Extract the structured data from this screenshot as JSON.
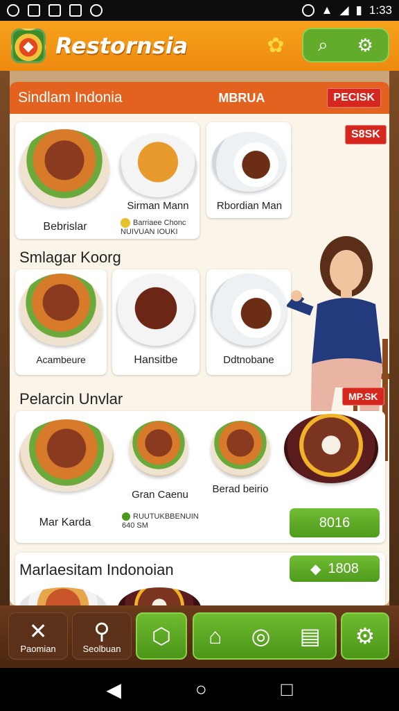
{
  "status": {
    "time": "1:33"
  },
  "app": {
    "title": "Restornsia"
  },
  "menu_header": {
    "left": "Sindlam Indonia",
    "middle": "MBRUA",
    "badge": "PECISK"
  },
  "row1": {
    "badge": "S8SK",
    "items": [
      {
        "label": "Bebrislar",
        "icon": "bowl"
      },
      {
        "label": "Sirman Mann",
        "icon": "noodles"
      },
      {
        "label": "Rbordian Man",
        "icon": "plate"
      }
    ],
    "note_line1": "Barriaee Chonc",
    "note_line2": "NUIVUAN IOUKI"
  },
  "section2": {
    "title": "Smlagar Koorg",
    "items": [
      {
        "label": "Acambeure"
      },
      {
        "label": "Hansitbe"
      },
      {
        "label": "Ddtnobane"
      }
    ]
  },
  "section3": {
    "title": "Pelarcin Unvlar",
    "badge": "MP.SK",
    "items": [
      {
        "label": "Mar Karda"
      },
      {
        "label": "Gran Caenu"
      },
      {
        "label": "Berad beirio"
      }
    ],
    "note_line1": "RUUTUKBBENUIN",
    "note_line2": "640 SM",
    "button": "8016"
  },
  "section4": {
    "title": "Marlaesitam Indonoian",
    "button": "1808"
  },
  "bottom_nav": [
    {
      "label": "Paomian",
      "icon": "utensils-icon"
    },
    {
      "label": "Seolbuan",
      "icon": "search-icon"
    },
    {
      "label": "",
      "icon": "box-icon"
    },
    {
      "label": "",
      "icon": "home-icon"
    },
    {
      "label": "",
      "icon": "chat-icon"
    },
    {
      "label": "",
      "icon": "list-icon"
    },
    {
      "label": "",
      "icon": "settings-icon"
    }
  ]
}
